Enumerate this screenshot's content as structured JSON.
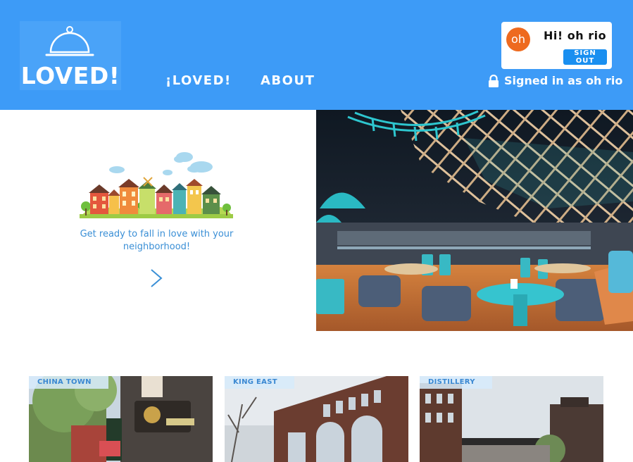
{
  "header": {
    "logo_text": "LOVED!",
    "nav": [
      {
        "label": "¡LOVED!"
      },
      {
        "label": "ABOUT"
      }
    ],
    "user": {
      "avatar_initials": "oh",
      "greeting": "Hi! oh rio",
      "sign_out_label": "SIGN OUT",
      "signed_in_text": "Signed in as oh rio"
    }
  },
  "hero": {
    "tagline": "Get ready to fall in love with your neighborhood!"
  },
  "neighborhoods": [
    {
      "label": "CHINA TOWN"
    },
    {
      "label": "KING EAST"
    },
    {
      "label": "DISTILLERY"
    }
  ],
  "colors": {
    "header_bg": "#3d9bf7",
    "accent_blue": "#1a8ff0",
    "avatar_orange": "#ee6a1f",
    "tagline_blue": "#3a8fd6"
  }
}
